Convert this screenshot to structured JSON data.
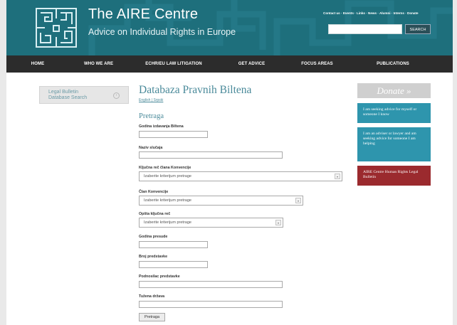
{
  "header": {
    "title": "The AIRE Centre",
    "tagline": "Advice on Individual Rights in Europe",
    "top_links": "Contact us · Events · Links · News · Alumni · Interns · Donate",
    "search_button": "SEARCH",
    "search_placeholder": ""
  },
  "nav": {
    "items": [
      "HOME",
      "WHO WE ARE",
      "ECHR/EU LAW LITIGATION",
      "GET ADVICE",
      "FOCUS AREAS",
      "PUBLICATIONS"
    ]
  },
  "left_sidebar": {
    "item_label": "Legal Bulletin Database Search",
    "arrow": "›"
  },
  "main": {
    "title": "Databaza Pravnih Biltena",
    "lang_links": "English | Srpski",
    "section_title": "Pretraga",
    "fields": {
      "year_bulletin": "Godina izdavanja Biltena",
      "case_name": "Naziv slučaja",
      "keyword_article": "Ključna reč člana Konvencije",
      "article": "Član Konvencije",
      "general_keyword": "Opšta ključna reč",
      "judgment_year": "Godina presude",
      "application_no": "Broj predstavke",
      "applicant": "Podnosilac predstavke",
      "respondent": "Tužena država"
    },
    "select_placeholder": "Izaberite kriterijum pretrage",
    "submit_label": "Pretraga"
  },
  "right_sidebar": {
    "donate": "Donate »",
    "box1": "I am seeking advice for myself or someone I know",
    "box2": "I am an adviser or lawyer and am seeking advice for someone I am helping",
    "box3": "AIRE Centre Human Rights Legal Bulletin"
  },
  "colors": {
    "header": "#1e6f7c",
    "nav": "#2c2c2c",
    "accent": "#4a8a9a",
    "teal_box": "#2e95ad",
    "red_box": "#9b2a2e",
    "donate_box": "#cfcfcf"
  }
}
